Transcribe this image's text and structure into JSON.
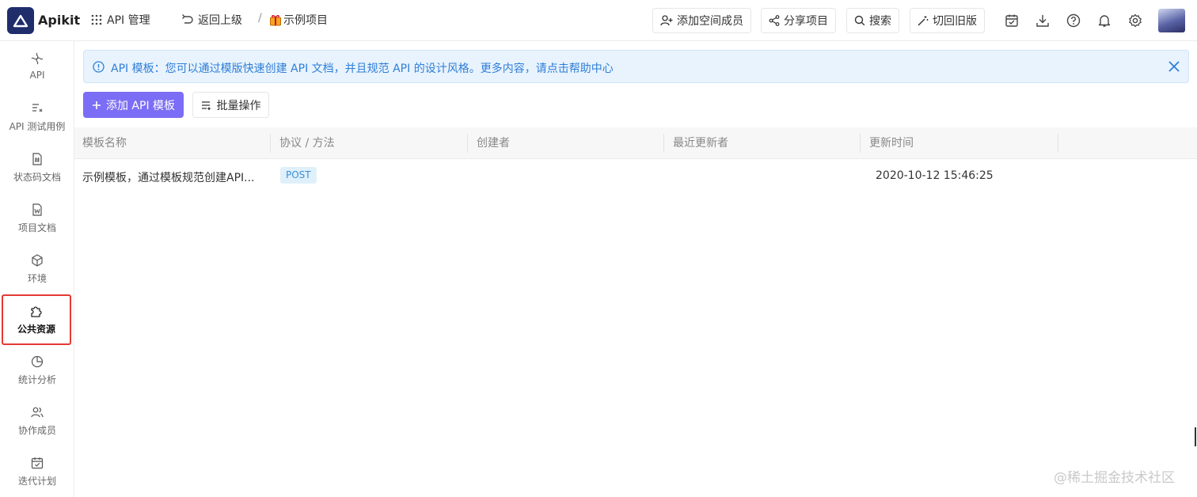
{
  "brand": {
    "name": "Apikit",
    "color": "#1f2d6b"
  },
  "topbar": {
    "menu_label": "API 管理",
    "back_label": "返回上级",
    "separator": "/",
    "project_name": "示例项目",
    "add_member": "添加空间成员",
    "share": "分享项目",
    "search": "搜索",
    "switch_old": "切回旧版",
    "icons": [
      "calendar-icon",
      "download-icon",
      "help-icon",
      "bell-icon",
      "gear-icon"
    ]
  },
  "sidebar": {
    "items": [
      {
        "label": "API",
        "icon": "api-icon"
      },
      {
        "label": "API 测试用例",
        "icon": "test-case-icon"
      },
      {
        "label": "状态码文档",
        "icon": "status-code-icon"
      },
      {
        "label": "项目文档",
        "icon": "word-doc-icon"
      },
      {
        "label": "环境",
        "icon": "environment-icon"
      },
      {
        "label": "公共资源",
        "icon": "puzzle-icon",
        "active": true
      },
      {
        "label": "统计分析",
        "icon": "pie-chart-icon"
      },
      {
        "label": "协作成员",
        "icon": "members-icon"
      },
      {
        "label": "迭代计划",
        "icon": "calendar-icon"
      }
    ]
  },
  "notice": {
    "text": "API 模板：您可以通过模版快速创建 API 文档，并且规范 API 的设计风格。更多内容，请点击帮助中心"
  },
  "toolbar": {
    "add_template": "添加 API 模板",
    "batch": "批量操作"
  },
  "table": {
    "columns": [
      "模板名称",
      "协议 / 方法",
      "创建者",
      "最近更新者",
      "更新时间"
    ],
    "rows": [
      {
        "name": "示例模板，通过模板规范创建API...",
        "method": "POST",
        "creator": "",
        "updater": "",
        "updated_at": "2020-10-12 15:46:25"
      }
    ]
  },
  "watermark": "@稀土掘金技术社区",
  "colors": {
    "primary": "#7b6df5",
    "notice_bg": "#e8f3fd",
    "notice_text": "#2f7ed8",
    "active_border": "#e53935"
  }
}
